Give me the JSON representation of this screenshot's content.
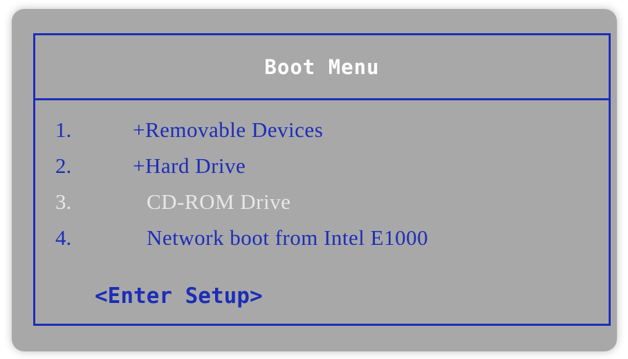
{
  "menu": {
    "title": "Boot Menu",
    "items": [
      {
        "number": "1.",
        "label": "+Removable Devices",
        "state": "normal"
      },
      {
        "number": "2.",
        "label": "+Hard Drive",
        "state": "normal"
      },
      {
        "number": "3.",
        "label": "CD-ROM Drive",
        "state": "highlighted"
      },
      {
        "number": "4.",
        "label": "Network boot from Intel E1000",
        "state": "normal"
      }
    ],
    "setup_label": "<Enter Setup>"
  },
  "colors": {
    "background": "#a8a8a8",
    "accent": "#1c2db8",
    "title_text": "#ffffff",
    "highlighted_text": "#e8e8e8"
  }
}
